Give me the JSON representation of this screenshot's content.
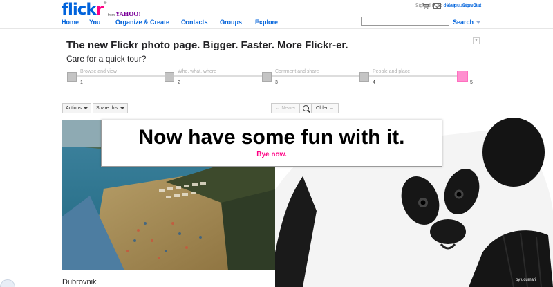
{
  "header": {
    "logo_main": "flick",
    "logo_r": "r",
    "logo_reg": "®",
    "from_label": "from",
    "yahoo_label": "YAHOO!",
    "signed_in_label": "Signed in as",
    "username": "duuuuuuuuuuuuu",
    "help_label": "Help",
    "signout_label": "Sign Out",
    "search_placeholder": "",
    "search_label": "Search",
    "icons": [
      "cart-icon",
      "mail-icon",
      "chevron-down-icon"
    ]
  },
  "nav": {
    "items": [
      {
        "label": "Home",
        "has_menu": false
      },
      {
        "label": "You",
        "has_menu": true
      },
      {
        "label": "Organize & Create",
        "has_menu": true
      },
      {
        "label": "Contacts",
        "has_menu": true
      },
      {
        "label": "Groups",
        "has_menu": true
      },
      {
        "label": "Explore",
        "has_menu": true
      }
    ]
  },
  "tour": {
    "close_label": "×",
    "title": "The new Flickr photo page. Bigger. Faster. More Flickr-er.",
    "subtitle": "Care for a quick tour?",
    "steps": [
      {
        "num": "1",
        "label": "Browse and view"
      },
      {
        "num": "2",
        "label": "Who, what, where"
      },
      {
        "num": "3",
        "label": "Comment and share"
      },
      {
        "num": "4",
        "label": "People and place"
      },
      {
        "num": "5",
        "label": ""
      }
    ],
    "active_step": 5
  },
  "toolbar": {
    "actions_label": "Actions",
    "share_label": "Share this",
    "newer_label": "← Newer",
    "older_label": "Older →"
  },
  "photo": {
    "caption": "Dubrovnik"
  },
  "panda": {
    "credit": "by ucumari"
  },
  "message": {
    "title": "Now have some fun with it.",
    "link": "Bye now."
  },
  "colors": {
    "flickr_blue": "#0063dc",
    "flickr_pink": "#ff0084",
    "yahoo_purple": "#7b0099"
  }
}
